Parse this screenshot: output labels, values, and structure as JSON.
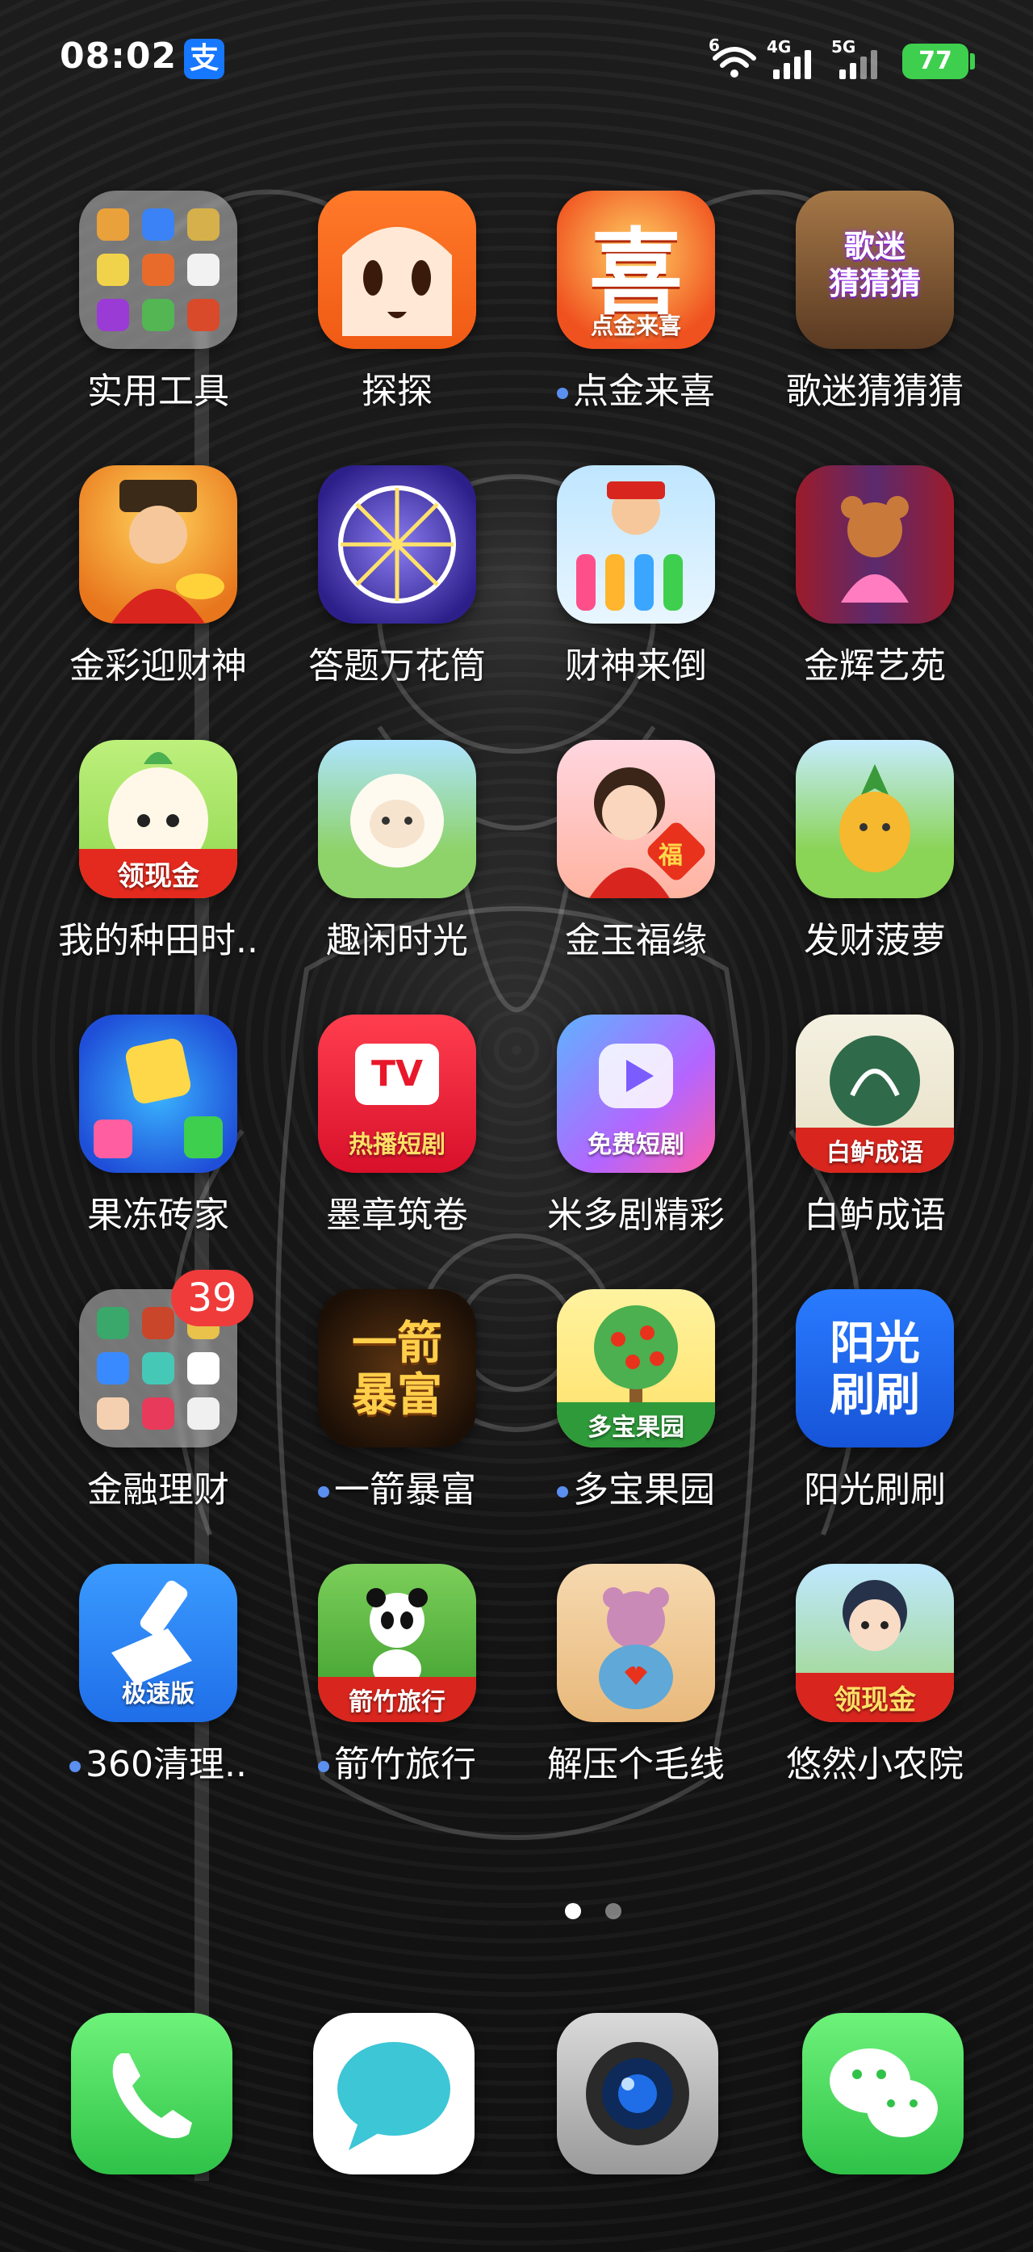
{
  "status": {
    "time": "08:02",
    "alipay_glyph": "支",
    "net1": "4G",
    "net2": "5G",
    "wifi_tag": "6",
    "battery": "77"
  },
  "apps": [
    {
      "label": "实用工具",
      "icon": "folder-icon"
    },
    {
      "label": "探探",
      "icon": "fox-icon"
    },
    {
      "label": "点金来喜",
      "icon": "xi-icon",
      "glyph": "喜",
      "overlay": "点金来喜"
    },
    {
      "label": "歌迷猜猜猜",
      "icon": "music-guess-icon",
      "overlay": "歌迷\n猜猜猜"
    },
    {
      "label": "金彩迎财神",
      "icon": "caishen-icon"
    },
    {
      "label": "答题万花筒",
      "icon": "kaleidoscope-icon"
    },
    {
      "label": "财神来倒",
      "icon": "caishen-tubes-icon"
    },
    {
      "label": "金辉艺苑",
      "icon": "bear-stage-icon"
    },
    {
      "label": "我的种田时..",
      "icon": "radish-icon",
      "overlay": "领现金"
    },
    {
      "label": "趣闲时光",
      "icon": "sheep-icon"
    },
    {
      "label": "金玉福缘",
      "icon": "fu-girl-icon",
      "glyph": "福"
    },
    {
      "label": "发财菠萝",
      "icon": "pineapple-icon"
    },
    {
      "label": "果冻砖家",
      "icon": "jelly-icon"
    },
    {
      "label": "墨章筑卷",
      "icon": "tv-icon",
      "glyph": "TV",
      "overlay": "热播短剧"
    },
    {
      "label": "米多剧精彩",
      "icon": "play-icon",
      "overlay": "免费短剧"
    },
    {
      "label": "白鲈成语",
      "icon": "idiom-icon",
      "overlay": "白鲈成语"
    },
    {
      "label": "金融理财",
      "icon": "folder-icon",
      "badge": "39"
    },
    {
      "label": "一箭暴富",
      "icon": "arrow-fortune-icon",
      "overlay": "一箭\n暴富"
    },
    {
      "label": "多宝果园",
      "icon": "tree-icon",
      "overlay": "多宝果园"
    },
    {
      "label": "阳光刷刷",
      "icon": "sunshine-icon",
      "overlay": "阳光\n刷刷"
    },
    {
      "label": "360清理..",
      "icon": "broom-icon",
      "overlay": "极速版"
    },
    {
      "label": "箭竹旅行",
      "icon": "panda-icon",
      "overlay": "箭竹旅行"
    },
    {
      "label": "解压个毛线",
      "icon": "yarn-bear-icon"
    },
    {
      "label": "悠然小农院",
      "icon": "farm-girl-icon",
      "overlay": "领现金"
    }
  ],
  "dock": [
    {
      "name": "phone",
      "icon": "phone-icon"
    },
    {
      "name": "messages",
      "icon": "message-icon"
    },
    {
      "name": "camera",
      "icon": "camera-icon"
    },
    {
      "name": "wechat",
      "icon": "wechat-icon"
    }
  ],
  "colors": {
    "accent_dot": "#5b8ff0",
    "badge": "#f03b3b",
    "battery": "#3ecf4e"
  }
}
